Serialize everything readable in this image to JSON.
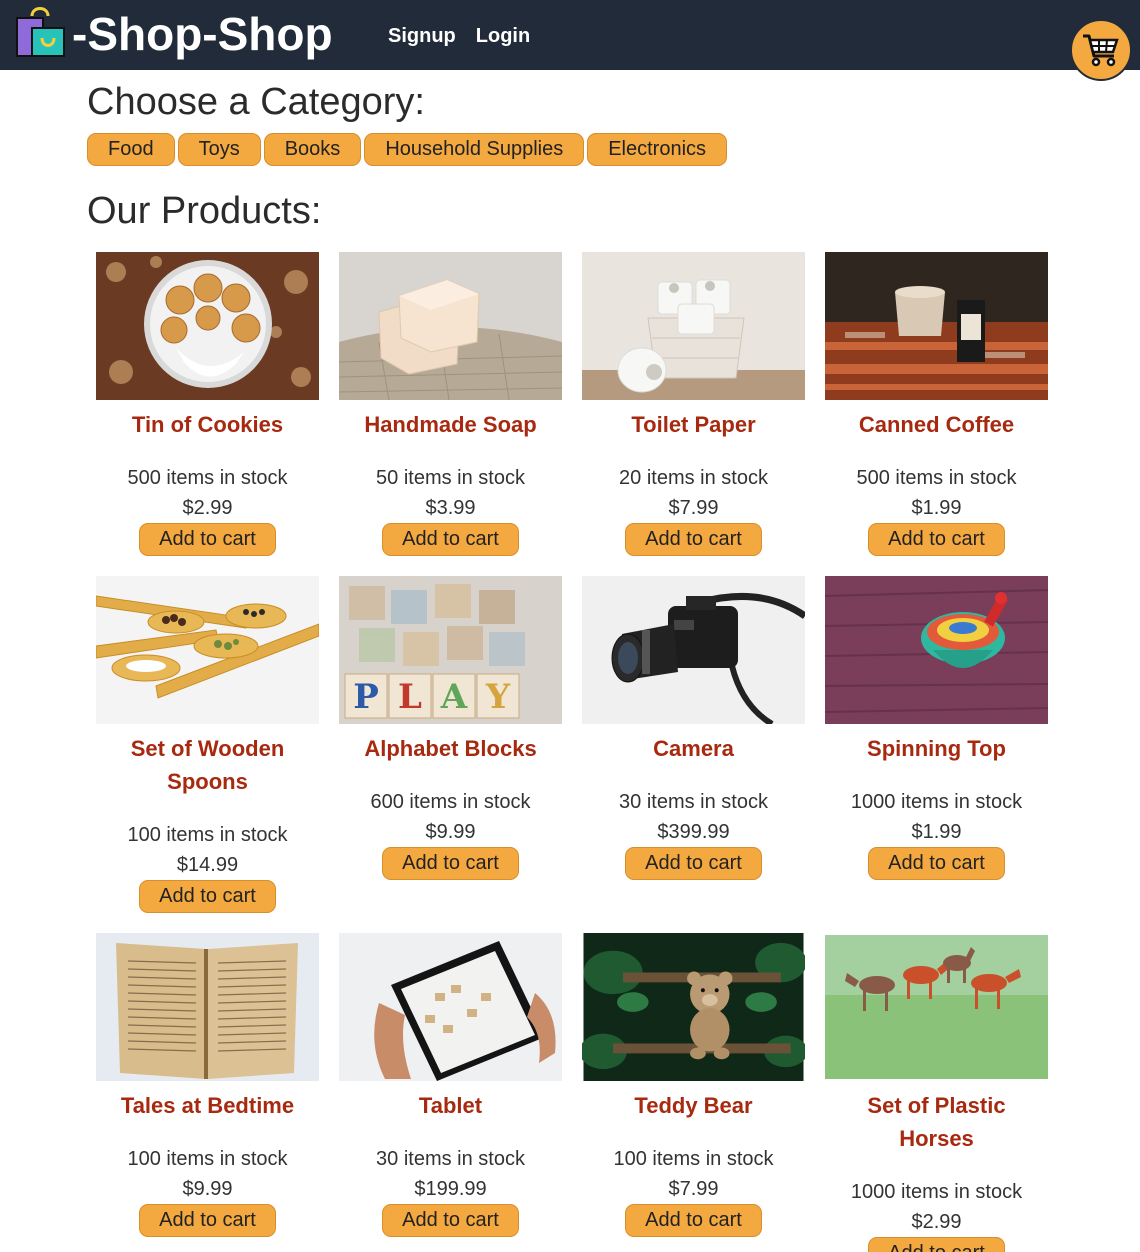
{
  "header": {
    "brand": "-Shop-Shop",
    "nav": {
      "signup": "Signup",
      "login": "Login"
    }
  },
  "categories": {
    "heading": "Choose a Category:",
    "items": [
      "Food",
      "Toys",
      "Books",
      "Household Supplies",
      "Electronics"
    ]
  },
  "products": {
    "heading": "Our Products:",
    "add_label": "Add to cart",
    "items": [
      {
        "name": "Tin of Cookies",
        "stock": "500 items in stock",
        "price": "$2.99",
        "image": "cookies"
      },
      {
        "name": "Handmade Soap",
        "stock": "50 items in stock",
        "price": "$3.99",
        "image": "soap"
      },
      {
        "name": "Toilet Paper",
        "stock": "20 items in stock",
        "price": "$7.99",
        "image": "toilet-paper"
      },
      {
        "name": "Canned Coffee",
        "stock": "500 items in stock",
        "price": "$1.99",
        "image": "coffee"
      },
      {
        "name": "Set of Wooden Spoons",
        "stock": "100 items in stock",
        "price": "$14.99",
        "image": "spoons"
      },
      {
        "name": "Alphabet Blocks",
        "stock": "600 items in stock",
        "price": "$9.99",
        "image": "blocks"
      },
      {
        "name": "Camera",
        "stock": "30 items in stock",
        "price": "$399.99",
        "image": "camera"
      },
      {
        "name": "Spinning Top",
        "stock": "1000 items in stock",
        "price": "$1.99",
        "image": "spinning-top"
      },
      {
        "name": "Tales at Bedtime",
        "stock": "100 items in stock",
        "price": "$9.99",
        "image": "book"
      },
      {
        "name": "Tablet",
        "stock": "30 items in stock",
        "price": "$199.99",
        "image": "tablet"
      },
      {
        "name": "Teddy Bear",
        "stock": "100 items in stock",
        "price": "$7.99",
        "image": "teddy-bear"
      },
      {
        "name": "Set of Plastic Horses",
        "stock": "1000 items in stock",
        "price": "$2.99",
        "image": "horses"
      }
    ]
  },
  "colors": {
    "header_bg": "#222b3a",
    "accent": "#f4a840",
    "product_name": "#a72a10"
  }
}
